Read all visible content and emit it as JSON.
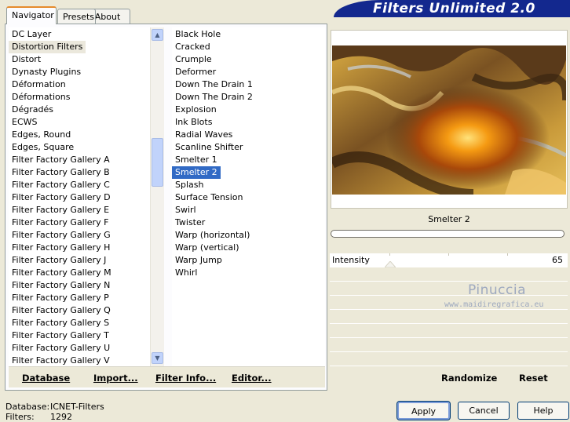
{
  "tabs": [
    {
      "label": "Navigator",
      "active": true
    },
    {
      "label": "Presets",
      "active": false
    },
    {
      "label": "About",
      "active": false
    }
  ],
  "banner": {
    "title": "Filters Unlimited 2.0"
  },
  "categories": {
    "items": [
      "DC Layer",
      "Distortion Filters",
      "Distort",
      "Dynasty Plugins",
      "Déformation",
      "Déformations",
      "Dégradés",
      "ECWS",
      "Edges, Round",
      "Edges, Square",
      "Filter Factory Gallery A",
      "Filter Factory Gallery B",
      "Filter Factory Gallery C",
      "Filter Factory Gallery D",
      "Filter Factory Gallery E",
      "Filter Factory Gallery F",
      "Filter Factory Gallery G",
      "Filter Factory Gallery H",
      "Filter Factory Gallery J",
      "Filter Factory Gallery M",
      "Filter Factory Gallery N",
      "Filter Factory Gallery P",
      "Filter Factory Gallery Q",
      "Filter Factory Gallery S",
      "Filter Factory Gallery T",
      "Filter Factory Gallery U",
      "Filter Factory Gallery V"
    ],
    "selected": "Distortion Filters"
  },
  "filters": {
    "items": [
      "Black Hole",
      "Cracked",
      "Crumple",
      "Deformer",
      "Down The Drain 1",
      "Down The Drain 2",
      "Explosion",
      "Ink Blots",
      "Radial Waves",
      "Scanline Shifter",
      "Smelter 1",
      "Smelter 2",
      "Splash",
      "Surface Tension",
      "Swirl",
      "Twister",
      "Warp (horizontal)",
      "Warp (vertical)",
      "Warp Jump",
      "Whirl"
    ],
    "selected": "Smelter 2"
  },
  "bottom_buttons": {
    "database": "Database",
    "import": "Import...",
    "filter_info": "Filter Info...",
    "editor": "Editor..."
  },
  "preview": {
    "filter_name": "Smelter 2"
  },
  "params": {
    "intensity_label": "Intensity",
    "intensity_value": "65",
    "intensity_level": 65,
    "intensity_max": 255
  },
  "watermark": {
    "name": "Pinuccia",
    "site": "www.maidiregrafica.eu"
  },
  "right_buttons": {
    "randomize": "Randomize",
    "reset": "Reset"
  },
  "status": {
    "database_label": "Database:",
    "database_value": "ICNET-Filters",
    "filters_label": "Filters:",
    "filters_value": "1292"
  },
  "dialog_buttons": {
    "apply": "Apply",
    "cancel": "Cancel",
    "help": "Help"
  },
  "colors": {
    "selection": "#316ac5",
    "banner": "#13288e",
    "tab_accent": "#e68b2c"
  }
}
